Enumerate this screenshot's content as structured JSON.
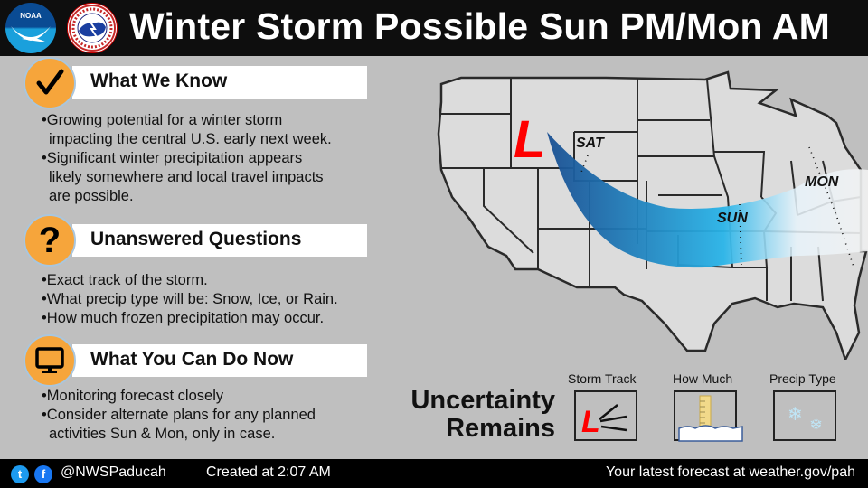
{
  "header": {
    "title": "Winter Storm Possible Sun PM/Mon AM",
    "logos": [
      {
        "name": "noaa-logo",
        "text": "NOAA"
      },
      {
        "name": "nws-logo",
        "text": "NATIONAL WEATHER SERVICE"
      }
    ]
  },
  "sections": [
    {
      "icon": "checkmark-icon",
      "heading": "What We Know",
      "bullets": [
        [
          "•Growing potential for a winter storm",
          "impacting the central U.S. early next week."
        ],
        [
          "•Significant winter precipitation appears",
          "likely somewhere and local travel impacts",
          "are possible."
        ]
      ]
    },
    {
      "icon": "question-mark-icon",
      "heading": "Unanswered Questions",
      "bullets": [
        [
          "•Exact track of the storm."
        ],
        [
          "•What precip type will be: Snow, Ice, or Rain."
        ],
        [
          "•How much frozen precipitation may occur."
        ]
      ]
    },
    {
      "icon": "monitor-icon",
      "heading": "What You Can Do Now",
      "bullets": [
        [
          "•Monitoring forecast closely"
        ],
        [
          "•Consider alternate plans for any planned",
          "activities Sun & Mon, only in case."
        ]
      ]
    }
  ],
  "map": {
    "low_symbol": "L",
    "day_labels": [
      "SAT",
      "SUN",
      "MON"
    ],
    "colors": {
      "low": "#ff0000",
      "track_dark": "#1f5fa5",
      "track_light": "#29b4e8",
      "land": "#dcdcdc",
      "border": "#222222"
    }
  },
  "uncertainty": {
    "title_line1": "Uncertainty",
    "title_line2": "Remains",
    "items": [
      {
        "label": "Storm Track",
        "icon": "storm-track-icon"
      },
      {
        "label": "How Much",
        "icon": "snow-ruler-icon"
      },
      {
        "label": "Precip Type",
        "icon": "snowflake-icon"
      }
    ]
  },
  "footer": {
    "handle": "@NWSPaducah",
    "created": "Created at 2:07 AM",
    "link_text": "Your latest forecast at weather.gov/pah"
  },
  "colors": {
    "badge": "#f6a53b",
    "header_bg": "#0e0e0e",
    "panel_bg": "#bfbfbf"
  }
}
